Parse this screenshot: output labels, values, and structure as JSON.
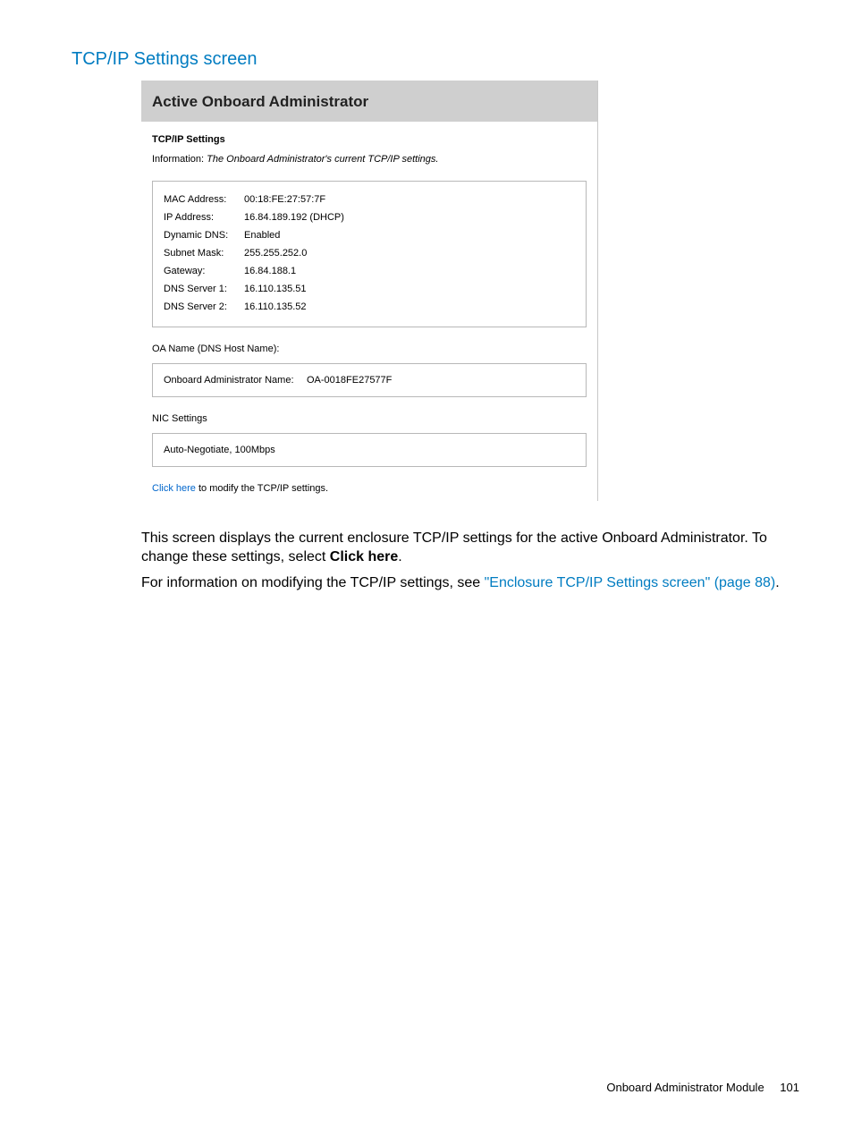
{
  "heading": "TCP/IP Settings screen",
  "screenshot": {
    "titlebar": "Active Onboard Administrator",
    "settings_title": "TCP/IP Settings",
    "info_label": "Information:",
    "info_text": "The Onboard Administrator's current TCP/IP settings.",
    "rows": {
      "mac_k": "MAC Address:",
      "mac_v": "00:18:FE:27:57:7F",
      "ip_k": "IP Address:",
      "ip_v": "16.84.189.192 (DHCP)",
      "ddns_k": "Dynamic DNS:",
      "ddns_v": "Enabled",
      "mask_k": "Subnet Mask:",
      "mask_v": "255.255.252.0",
      "gw_k": "Gateway:",
      "gw_v": "16.84.188.1",
      "dns1_k": "DNS Server 1:",
      "dns1_v": "16.110.135.51",
      "dns2_k": "DNS Server 2:",
      "dns2_v": "16.110.135.52"
    },
    "oa_section_label": "OA Name  (DNS Host Name):",
    "oa_row_k": "Onboard Administrator Name:",
    "oa_row_v": "OA-0018FE27577F",
    "nic_section_label": "NIC Settings",
    "nic_value": "Auto-Negotiate, 100Mbps",
    "click_link": "Click here",
    "click_after": " to modify the TCP/IP settings."
  },
  "narrative": {
    "p1a": "This screen displays the current enclosure TCP/IP settings for the active Onboard Administrator. To change these settings, select ",
    "p1b": "Click here",
    "p1c": ".",
    "p2a": "For information on modifying the TCP/IP settings, see ",
    "p2b": "\"Enclosure TCP/IP Settings screen\" (page 88)",
    "p2c": "."
  },
  "footer": {
    "section": "Onboard Administrator Module",
    "page": "101"
  }
}
